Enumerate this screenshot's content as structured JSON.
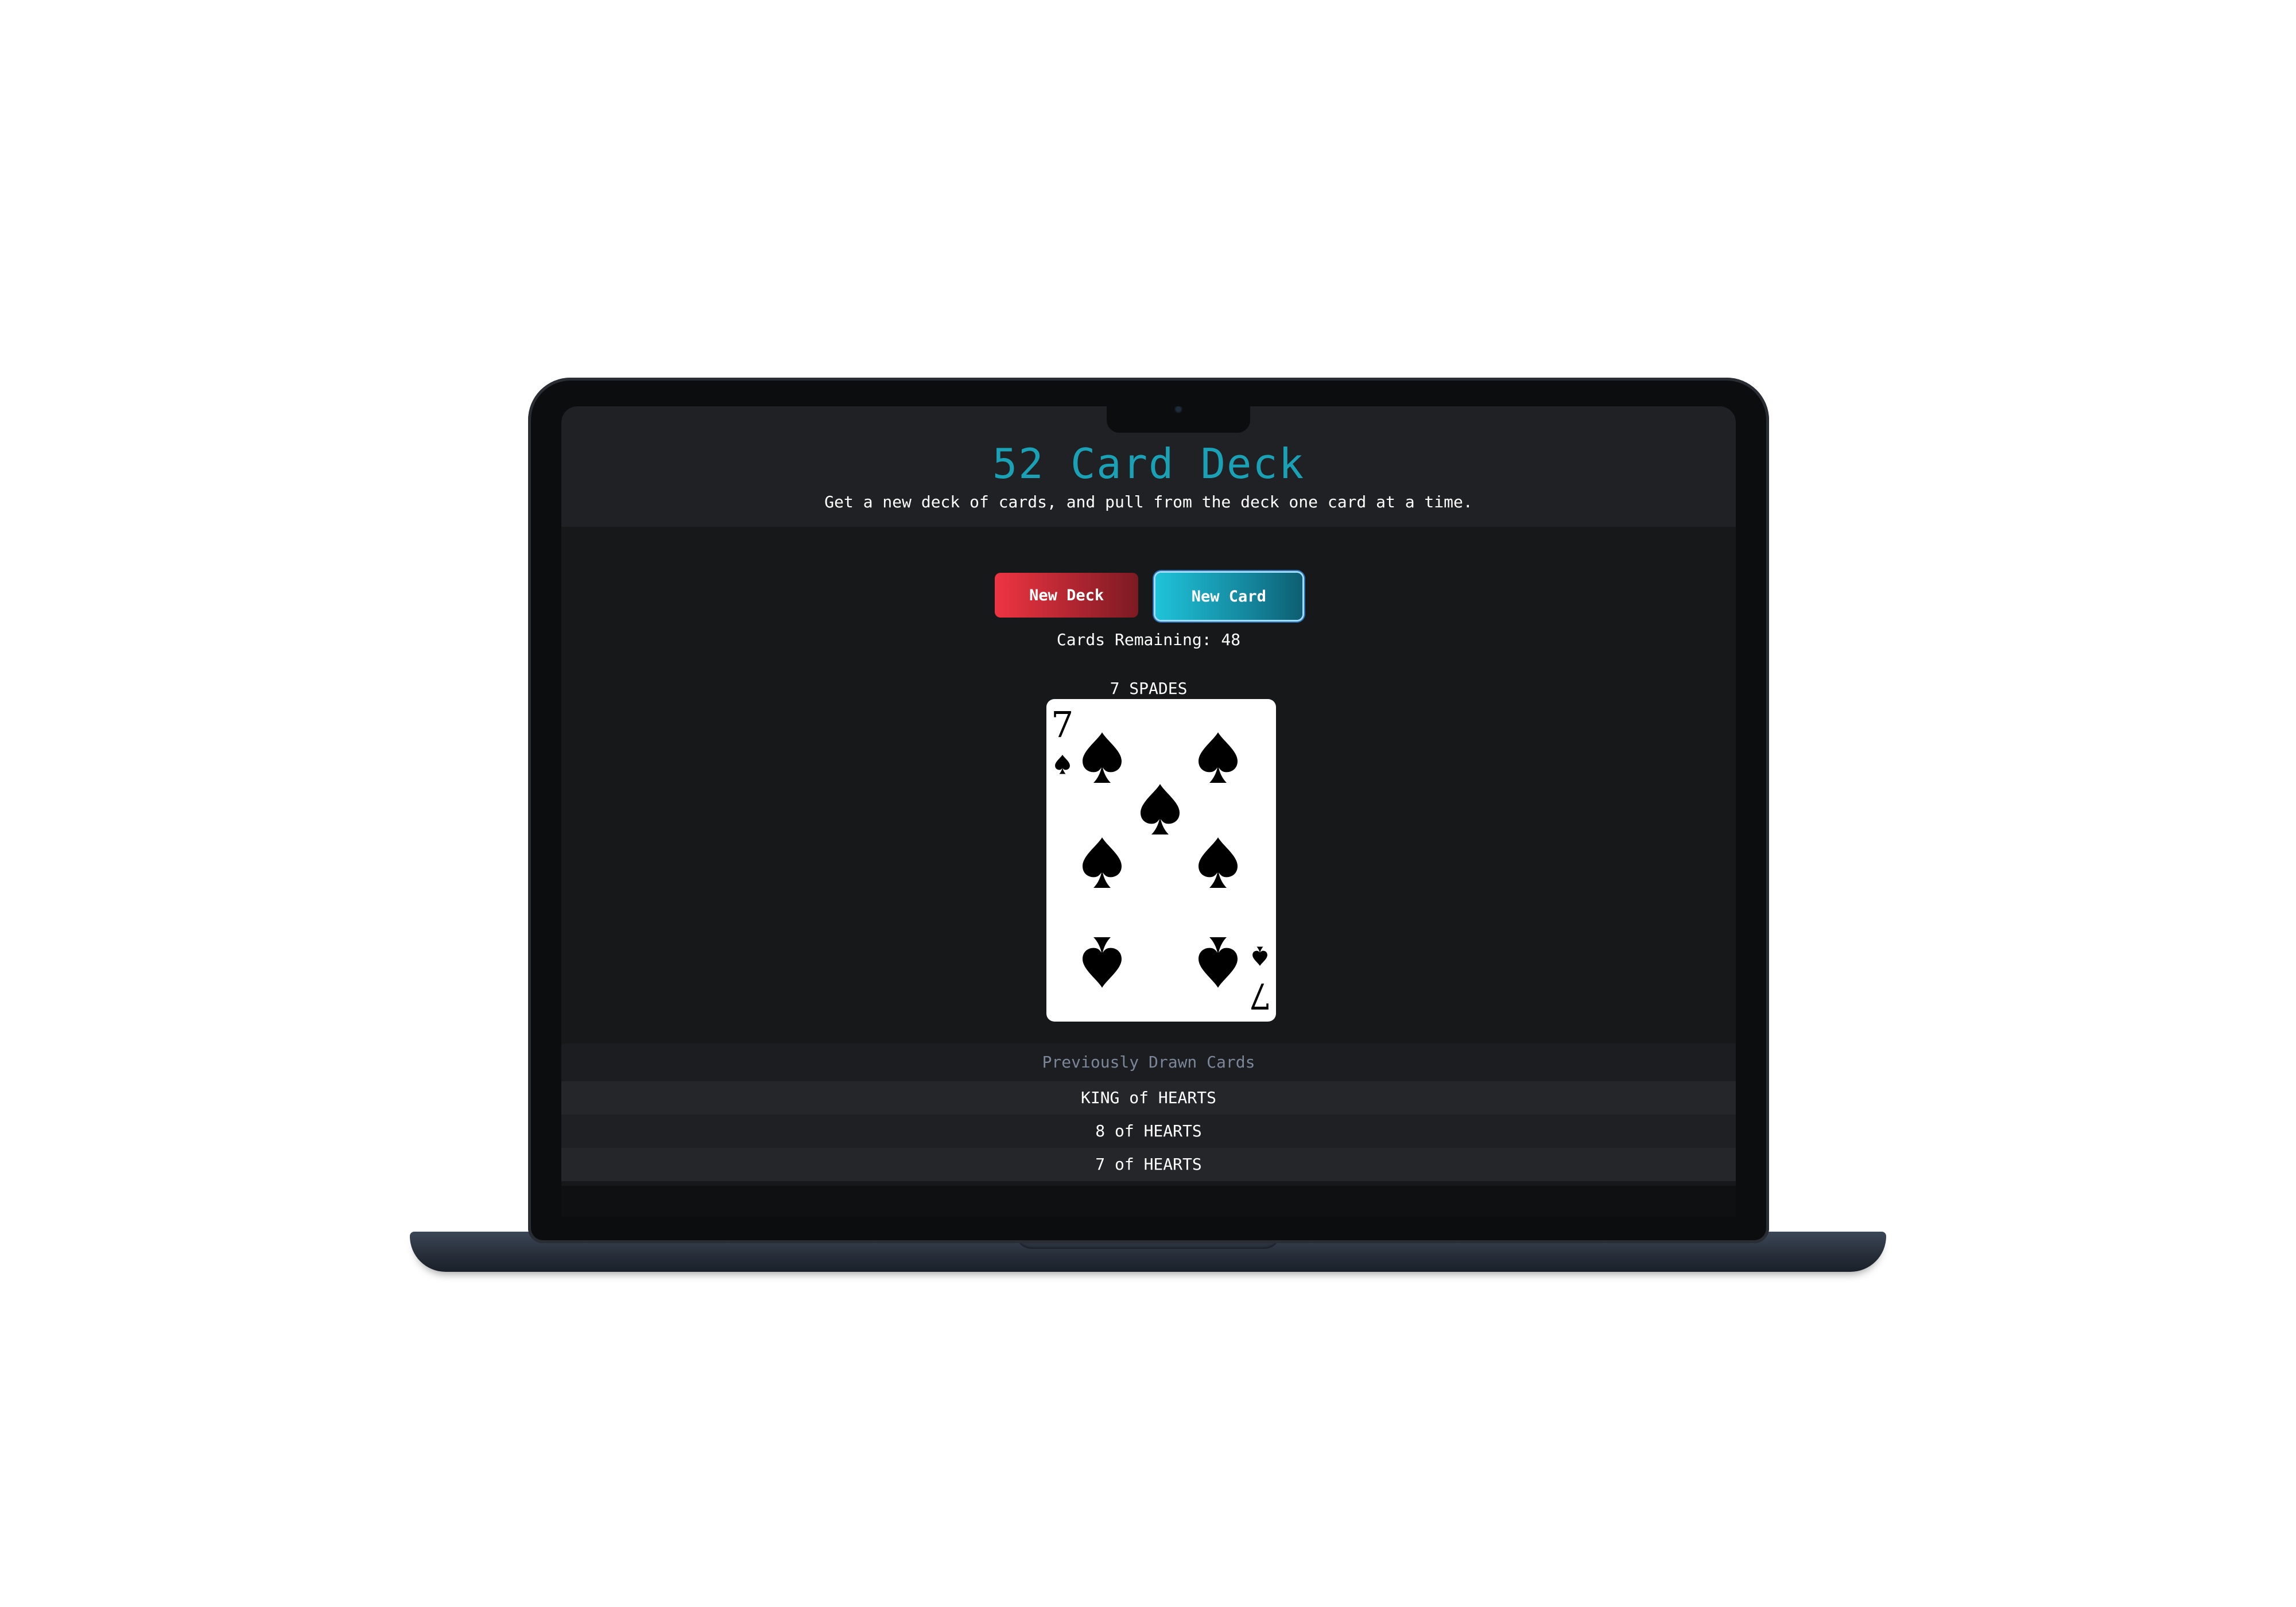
{
  "app": {
    "title": "52 Card Deck",
    "subtitle": "Get a new deck of cards, and pull from the deck one card at a time."
  },
  "controls": {
    "new_deck_label": "New Deck",
    "new_card_label": "New Card"
  },
  "status": {
    "remaining_label": "Cards Remaining: 48"
  },
  "current_card": {
    "label": "7 SPADES",
    "rank": "7",
    "suit": "spades",
    "suit_icon": "spade-icon"
  },
  "history": {
    "heading": "Previously Drawn Cards",
    "items": [
      "KING of HEARTS",
      "8 of HEARTS",
      "7 of HEARTS"
    ]
  },
  "colors": {
    "title": "#1ba1b5",
    "new_deck_button": "#ef3442",
    "new_card_button": "#1fc3d9",
    "background": "#171819"
  }
}
